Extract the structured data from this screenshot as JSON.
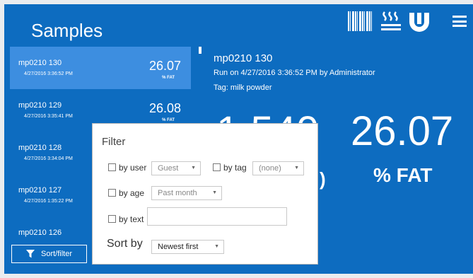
{
  "header": {
    "title": "Samples",
    "icons": [
      "barcode-icon",
      "heat-icon",
      "brand-logo",
      "hamburger-menu-icon"
    ]
  },
  "samples": [
    {
      "name": "mp0210 130",
      "date": "4/27/2016 3:36:52 PM",
      "value": "26.07",
      "unit": "% FAT",
      "selected": true
    },
    {
      "name": "mp0210 129",
      "date": "4/27/2016 3:35:41 PM",
      "value": "26.08",
      "unit": "% FAT"
    },
    {
      "name": "mp0210 128",
      "date": "4/27/2016 3:34:04 PM"
    },
    {
      "name": "mp0210 127",
      "date": "4/27/2016 1:35:22 PM"
    },
    {
      "name": "mp0210 126"
    }
  ],
  "sort_filter_button": "Sort/filter",
  "detail": {
    "title": "mp0210 130",
    "run_text": "Run on 4/27/2016 3:36:52 PM  by Administrator",
    "tag_text": "Tag: milk powder",
    "big_value_left": "1.540",
    "big_value_right": "26.07",
    "paren": ")",
    "fat_label": "% FAT"
  },
  "filter": {
    "title": "Filter",
    "by_user_label": "by user",
    "user_value": "Guest",
    "by_tag_label": "by tag",
    "tag_value": "(none)",
    "by_age_label": "by age",
    "age_value": "Past month",
    "by_text_label": "by text",
    "text_value": "",
    "sort_by_label": "Sort by",
    "sort_value": "Newest first"
  },
  "colors": {
    "background": "#0d6cc0",
    "selected": "#3d8ee0",
    "popup": "#ffffff"
  }
}
